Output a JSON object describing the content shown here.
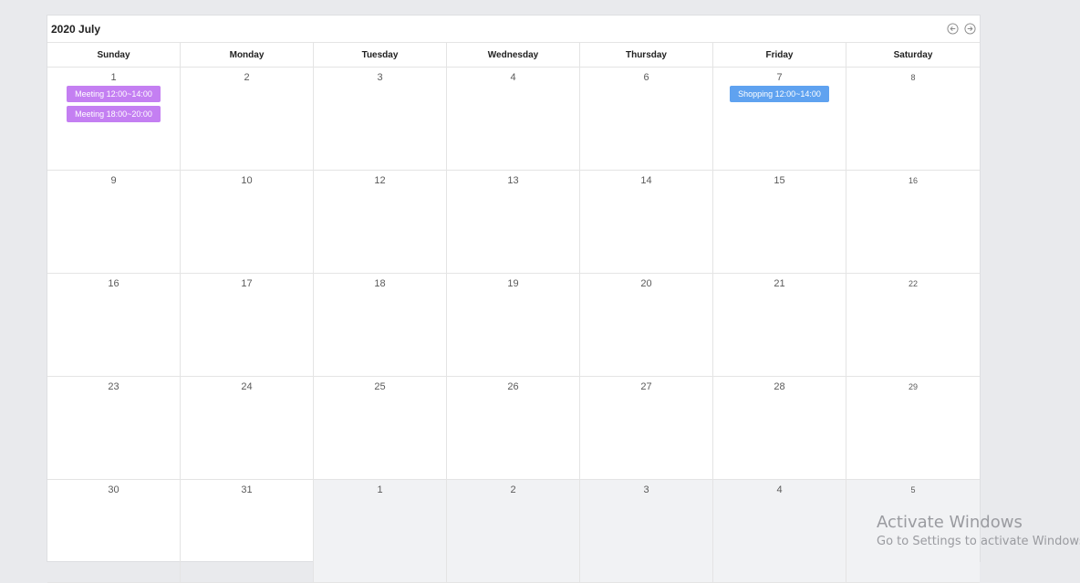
{
  "calendar": {
    "title": "2020 July",
    "weekdays": [
      "Sunday",
      "Monday",
      "Tuesday",
      "Wednesday",
      "Thursday",
      "Friday",
      "Saturday"
    ],
    "weeks": [
      [
        {
          "day": "1",
          "current": true,
          "events": [
            {
              "label": "Meeting 12:00~14:00",
              "color": "#c47ff2"
            },
            {
              "label": "Meeting 18:00~20:00",
              "color": "#c47ff2"
            }
          ]
        },
        {
          "day": "2",
          "current": true,
          "events": []
        },
        {
          "day": "3",
          "current": true,
          "events": []
        },
        {
          "day": "4",
          "current": true,
          "events": []
        },
        {
          "day": "6",
          "current": true,
          "events": []
        },
        {
          "day": "7",
          "current": true,
          "events": [
            {
              "label": "Shopping 12:00~14:00",
              "color": "#5fa2f0"
            }
          ]
        },
        {
          "day": "8",
          "current": true,
          "events": []
        }
      ],
      [
        {
          "day": "9",
          "current": true,
          "events": []
        },
        {
          "day": "10",
          "current": true,
          "events": []
        },
        {
          "day": "12",
          "current": true,
          "events": []
        },
        {
          "day": "13",
          "current": true,
          "events": []
        },
        {
          "day": "14",
          "current": true,
          "events": []
        },
        {
          "day": "15",
          "current": true,
          "events": []
        },
        {
          "day": "16",
          "current": true,
          "events": []
        }
      ],
      [
        {
          "day": "16",
          "current": true,
          "events": []
        },
        {
          "day": "17",
          "current": true,
          "events": []
        },
        {
          "day": "18",
          "current": true,
          "events": []
        },
        {
          "day": "19",
          "current": true,
          "events": []
        },
        {
          "day": "20",
          "current": true,
          "events": []
        },
        {
          "day": "21",
          "current": true,
          "events": []
        },
        {
          "day": "22",
          "current": true,
          "events": []
        }
      ],
      [
        {
          "day": "23",
          "current": true,
          "events": []
        },
        {
          "day": "24",
          "current": true,
          "events": []
        },
        {
          "day": "25",
          "current": true,
          "events": []
        },
        {
          "day": "26",
          "current": true,
          "events": []
        },
        {
          "day": "27",
          "current": true,
          "events": []
        },
        {
          "day": "28",
          "current": true,
          "events": []
        },
        {
          "day": "29",
          "current": true,
          "events": []
        }
      ],
      [
        {
          "day": "30",
          "current": true,
          "events": []
        },
        {
          "day": "31",
          "current": true,
          "events": []
        },
        {
          "day": "1",
          "current": false,
          "events": []
        },
        {
          "day": "2",
          "current": false,
          "events": []
        },
        {
          "day": "3",
          "current": false,
          "events": []
        },
        {
          "day": "4",
          "current": false,
          "events": []
        },
        {
          "day": "5",
          "current": false,
          "events": []
        }
      ]
    ],
    "nav": {
      "prev_icon": "arrow-left-circle-icon",
      "next_icon": "arrow-right-circle-icon"
    }
  },
  "watermark": {
    "line1": "Activate Windows",
    "line2": "Go to Settings to activate Windows."
  }
}
